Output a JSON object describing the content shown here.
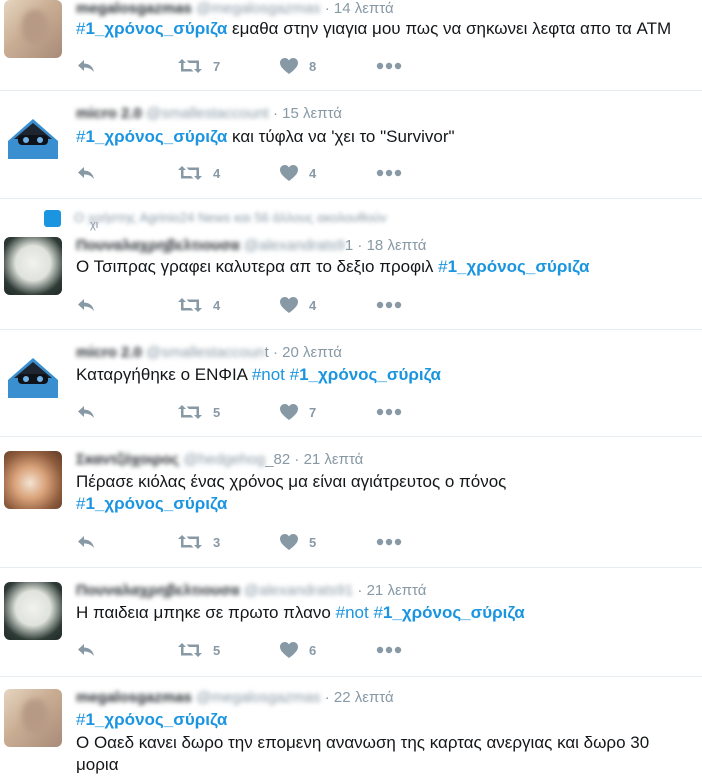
{
  "tweets": [
    {
      "name": "megalosgazmas",
      "handle": "@megalosgazmas",
      "handle_tail": "",
      "time": "14 λεπτά",
      "text_parts": [
        {
          "t": "#",
          "hash": true
        },
        {
          "t": "1_χρόνος_σύριζα",
          "hash": true,
          "bold": true
        },
        {
          "t": " εμαθα στην γιαγια μου πως να σηκωνει λεφτα απο τα ATM",
          "hash": false
        }
      ],
      "retweets": "7",
      "likes": "8"
    },
    {
      "name": "micro 2.0",
      "handle": "@smallestaccount",
      "handle_tail": "",
      "time": "15 λεπτά",
      "text_parts": [
        {
          "t": "#",
          "hash": true
        },
        {
          "t": "1_χρόνος_σύριζα",
          "hash": true,
          "bold": true
        },
        {
          "t": " και τύφλα να 'χει το \"Survivor\"",
          "hash": false
        }
      ],
      "retweets": "4",
      "likes": "4"
    },
    {
      "name": "Πουναλαχρηβελτιουσα",
      "handle": "@alexandrats9",
      "handle_tail": "1",
      "time": "18 λεπτά",
      "text_parts": [
        {
          "t": "Ο Τσιπρας γραφει καλυτερα απ το δεξιο προφιλ ",
          "hash": false
        },
        {
          "t": "#",
          "hash": true
        },
        {
          "t": "1_χρόνος_σύριζα",
          "hash": true,
          "bold": true
        }
      ],
      "retweets": "4",
      "likes": "4"
    },
    {
      "name": "micro 2.0",
      "handle": "@smallestaccoun",
      "handle_tail": "t",
      "time": "20 λεπτά",
      "text_parts": [
        {
          "t": "Καταργήθηκε ο ΕΝΦΙΑ ",
          "hash": false
        },
        {
          "t": "#not",
          "hash": true
        },
        {
          "t": " ",
          "hash": false
        },
        {
          "t": "#",
          "hash": true
        },
        {
          "t": "1_χρόνος_σύριζα",
          "hash": true,
          "bold": true
        }
      ],
      "retweets": "5",
      "likes": "7"
    },
    {
      "name": "Σκαντζόχοιρος",
      "handle": "@hedgehog",
      "handle_tail": "_82",
      "time": "21 λεπτά",
      "text_parts": [
        {
          "t": "Πέρασε κιόλας ένας χρόνος μα είναι αγιάτρευτος ο πόνος",
          "hash": false
        }
      ],
      "text_parts_2": [
        {
          "t": "#",
          "hash": true
        },
        {
          "t": "1_χρόνος_σύριζα",
          "hash": true,
          "bold": true
        }
      ],
      "retweets": "3",
      "likes": "5"
    },
    {
      "name": "Πουναλαχρηβελτιουσα",
      "handle": "@alexandrats91",
      "handle_tail": "",
      "time": "21 λεπτά",
      "text_parts": [
        {
          "t": "Η παιδεια μπηκε σε πρωτο πλανο ",
          "hash": false
        },
        {
          "t": "#not",
          "hash": true
        },
        {
          "t": " ",
          "hash": false
        },
        {
          "t": "#",
          "hash": true
        },
        {
          "t": "1_χρόνος_σύριζα",
          "hash": true,
          "bold": true
        }
      ],
      "retweets": "5",
      "likes": "6"
    },
    {
      "name": "megalosgazmas",
      "handle": "@megalosgazmas",
      "handle_tail": "",
      "time": "22 λεπτά",
      "text_parts": [
        {
          "t": "#",
          "hash": true
        },
        {
          "t": "1_χρόνος_σύριζα",
          "hash": true,
          "bold": true
        }
      ],
      "text_parts_2": [
        {
          "t": "Ο Οαεδ κανει δωρο την επομενη ανανωση της καρτας ανεργιας και δωρο 30",
          "hash": false
        }
      ],
      "text_parts_3": [
        {
          "t": "μορια",
          "hash": false
        }
      ],
      "retweets": "",
      "likes": ""
    }
  ],
  "social_context": {
    "text": "Ο χρήστης Agrinio24 News και 56 άλλους ακολουθούν",
    "fragment": "χι",
    "icon": "user-icon"
  },
  "colors": {
    "hashtag": "#1b95e0",
    "meta": "#8899a6",
    "divider": "#e6ecf0"
  },
  "icons": [
    "reply-icon",
    "retweet-icon",
    "like-icon",
    "more-icon"
  ]
}
